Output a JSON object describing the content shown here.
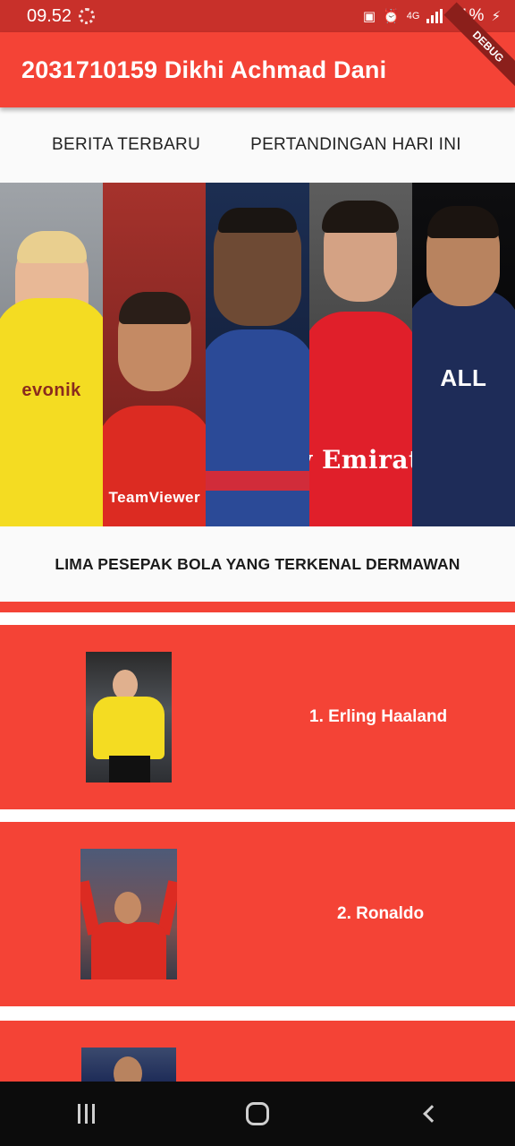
{
  "status_bar": {
    "time": "09.52",
    "network": "4G",
    "battery": "91%"
  },
  "app_bar": {
    "title": "2031710159 Dikhi Achmad Dani",
    "debug_label": "DEBUG"
  },
  "tabs": [
    {
      "label": "BERITA TERBARU"
    },
    {
      "label": "PERTANDINGAN HARI INI"
    }
  ],
  "banner": {
    "panels": [
      {
        "sponsor": "evonik"
      },
      {
        "sponsor": "TeamViewer"
      },
      {
        "sponsor": ""
      },
      {
        "sponsor": "Fly Emirates"
      },
      {
        "sponsor": "ALL"
      }
    ]
  },
  "section": {
    "title": "LIMA PESEPAK BOLA YANG TERKENAL DERMAWAN"
  },
  "players": [
    {
      "label": "1. Erling Haaland",
      "image": "haaland-photo"
    },
    {
      "label": "2. Ronaldo",
      "image": "ronaldo-photo"
    },
    {
      "label": "",
      "image": "player-photo"
    }
  ],
  "nav": {
    "recent": "recent-apps-icon",
    "home": "home-icon",
    "back": "back-icon"
  },
  "colors": {
    "primary": "#f44336",
    "status_bar": "#c8302a",
    "nav_bar": "#0c0c0c"
  }
}
